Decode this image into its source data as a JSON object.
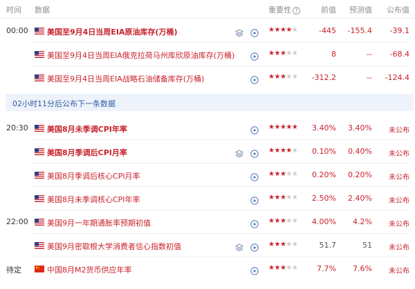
{
  "header": {
    "time": "时间",
    "data": "数据",
    "importance": "重要性",
    "info_symbol": "?",
    "previous": "前值",
    "forecast": "预测值",
    "actual": "公布值"
  },
  "icon_names": {
    "stack": "layers-icon",
    "play": "play-circle-icon",
    "info": "question-icon"
  },
  "colors": {
    "red": "#c8232c",
    "notice_bg": "#eef3fb",
    "notice_text": "#2e5d9e",
    "star_off": "#c9ccd2"
  },
  "notice": "02小时11分后公布下一条数据",
  "rows": [
    {
      "time": "00:00",
      "country": "us",
      "title": "美国至9月4日当周EIA原油库存(万桶)",
      "stars": 4,
      "previous": "-445",
      "forecast": "-155.4",
      "actual": "-39.1"
    },
    {
      "time": "",
      "country": "us",
      "title": "美国至9月4日当周EIA俄克拉荷马州库欣原油库存(万桶)",
      "stars": 3,
      "previous": "8",
      "forecast": "--",
      "actual": "-68.4"
    },
    {
      "time": "",
      "country": "us",
      "title": "美国至9月4日当周EIA战略石油储备库存(万桶)",
      "stars": 3,
      "previous": "-312.2",
      "forecast": "--",
      "actual": "-124.4"
    },
    {
      "time": "20:30",
      "country": "us",
      "title": "美国8月未季调CPI年率",
      "stars": 5,
      "previous": "3.40%",
      "forecast": "3.40%",
      "actual": "未公布"
    },
    {
      "time": "",
      "country": "us",
      "title": "美国8月季调后CPI月率",
      "stars": 4,
      "previous": "0.10%",
      "forecast": "0.40%",
      "actual": "未公布"
    },
    {
      "time": "",
      "country": "us",
      "title": "美国8月季调后核心CPI月率",
      "stars": 3,
      "previous": "0.20%",
      "forecast": "0.20%",
      "actual": "未公布"
    },
    {
      "time": "",
      "country": "us",
      "title": "美国8月未季调核心CPI年率",
      "stars": 3,
      "previous": "2.50%",
      "forecast": "2.40%",
      "actual": "未公布"
    },
    {
      "time": "22:00",
      "country": "us",
      "title": "美国9月一年期通胀率预期初值",
      "stars": 3,
      "previous": "4.00%",
      "forecast": "4.2%",
      "actual": "未公布"
    },
    {
      "time": "",
      "country": "us",
      "title": "美国9月密歇根大学消费者信心指数初值",
      "stars": 3,
      "previous": "51.7",
      "forecast": "51",
      "actual": "未公布"
    },
    {
      "time": "待定",
      "country": "cn",
      "title": "中国8月M2货币供应年率",
      "stars": 3,
      "previous": "7.7%",
      "forecast": "7.6%",
      "actual": "未公布"
    }
  ]
}
